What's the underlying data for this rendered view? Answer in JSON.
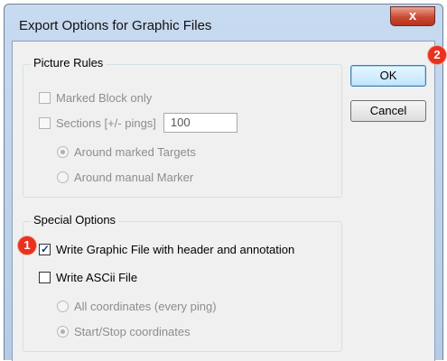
{
  "window": {
    "title": "Export Options for Graphic Files",
    "close_label": "x"
  },
  "picture_rules": {
    "title": "Picture Rules",
    "marked_block_label": "Marked Block only",
    "sections_label": "Sections [+/- pings]",
    "sections_value": "100",
    "around_targets_label": "Around marked Targets",
    "around_marker_label": "Around manual Marker"
  },
  "special_options": {
    "title": "Special Options",
    "write_graphic_label": "Write Graphic File with header and annotation",
    "write_ascii_label": "Write ASCii File",
    "all_coordinates_label": "All coordinates (every ping)",
    "start_stop_label": "Start/Stop coordinates"
  },
  "buttons": {
    "ok_label": "OK",
    "cancel_label": "Cancel"
  },
  "callouts": {
    "one": "1",
    "two": "2"
  },
  "colors": {
    "callout": "#e8321d",
    "title_bar": "#c7daf0",
    "close_button": "#c94a33"
  }
}
